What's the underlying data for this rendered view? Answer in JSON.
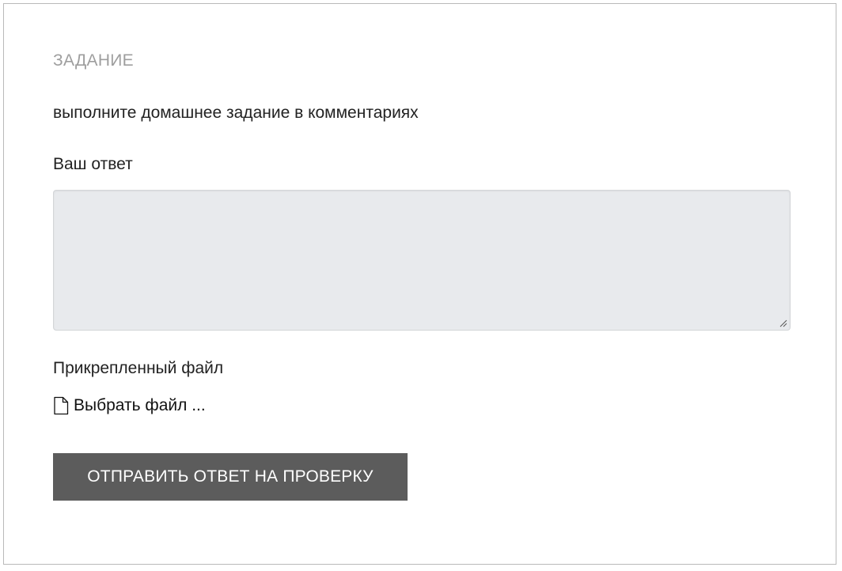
{
  "task": {
    "section_title": "ЗАДАНИЕ",
    "description": "выполните домашнее задание в комментариях"
  },
  "answer": {
    "label": "Ваш ответ",
    "value": ""
  },
  "attachment": {
    "label": "Прикрепленный файл",
    "picker_text": "Выбрать файл ...",
    "icon": "file-icon"
  },
  "submit": {
    "label": "ОТПРАВИТЬ ОТВЕТ НА ПРОВЕРКУ",
    "background": "#5c5c5c",
    "text_color": "#ffffff"
  },
  "colors": {
    "section_title": "#9e9e9e",
    "textarea_bg": "#e8eaed",
    "frame_border": "#b9b9b9"
  }
}
